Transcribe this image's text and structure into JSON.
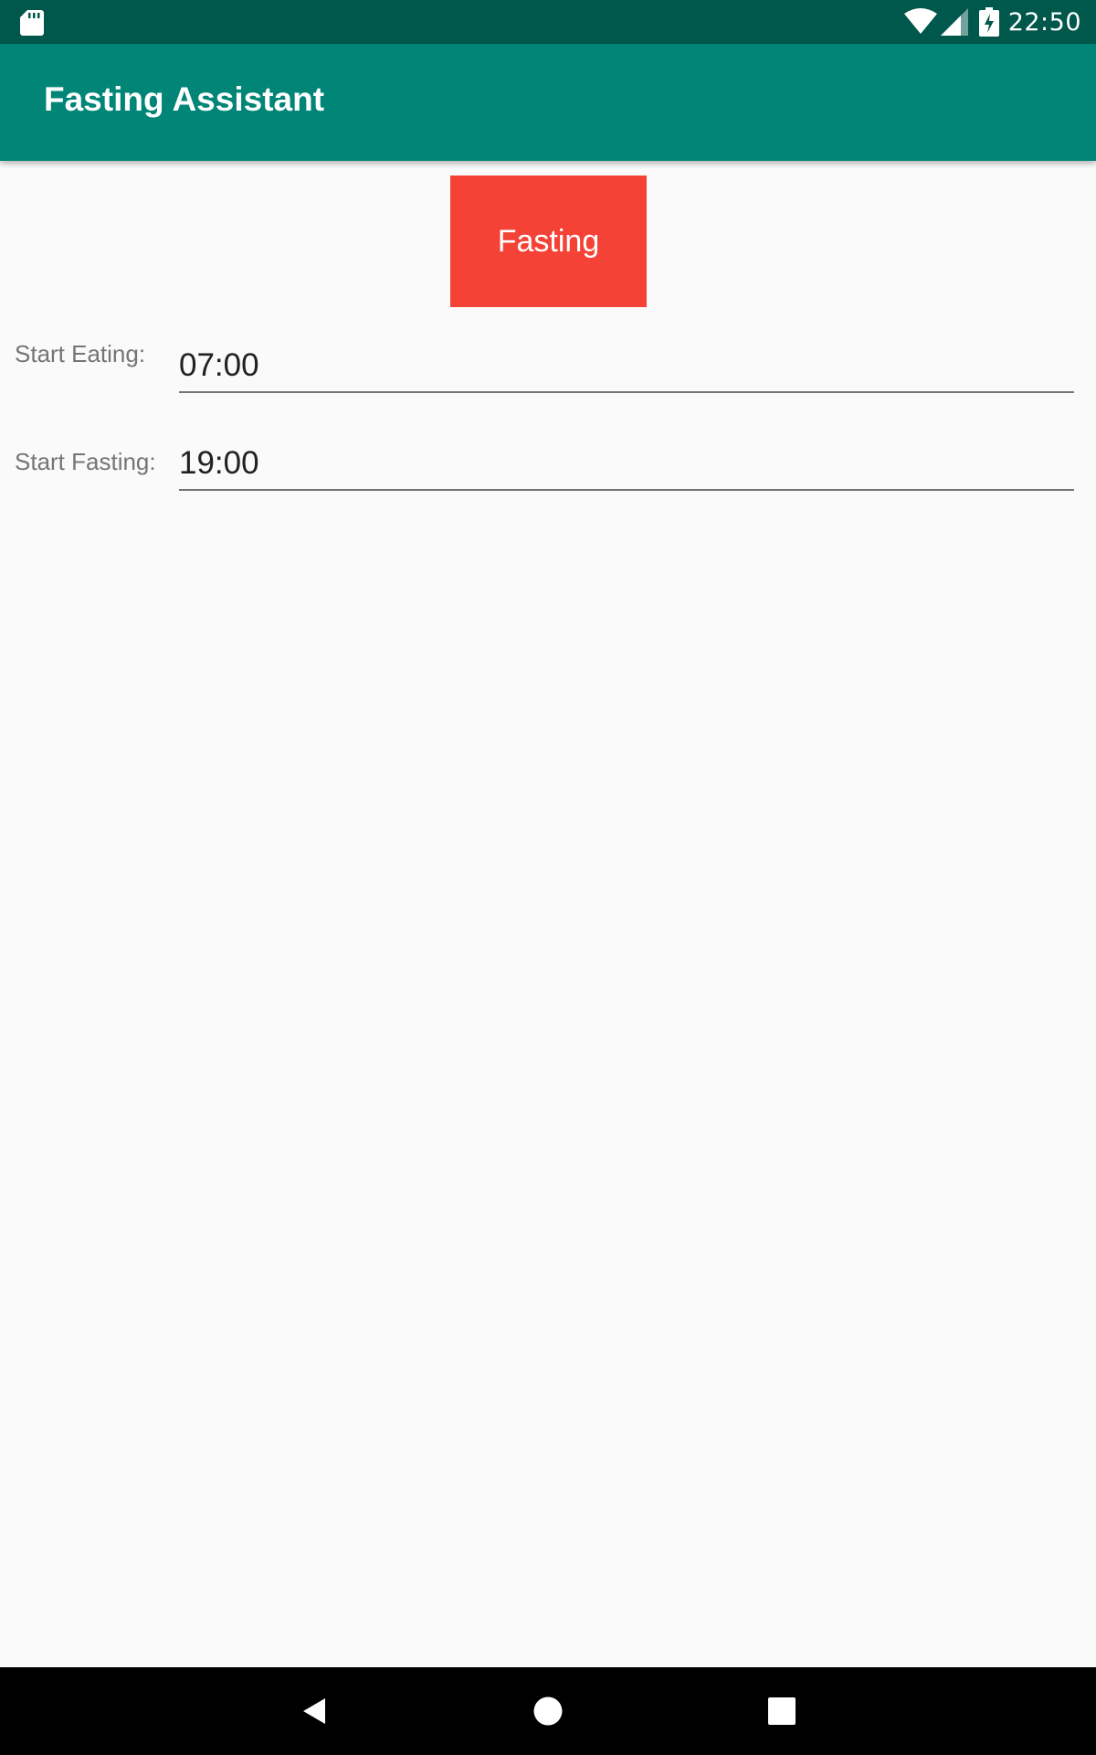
{
  "status_bar": {
    "time": "22:50",
    "icons": [
      "sd-card-icon",
      "wifi-icon",
      "cell-signal-icon",
      "battery-charging-icon"
    ]
  },
  "app_bar": {
    "title": "Fasting Assistant"
  },
  "status_button": {
    "label": "Fasting",
    "color": "#f44336"
  },
  "fields": [
    {
      "label": "Start Eating:",
      "value": "07:00"
    },
    {
      "label": "Start Fasting:",
      "value": "19:00"
    }
  ],
  "nav_bar": {
    "icons": [
      "back-icon",
      "home-icon",
      "recents-icon"
    ]
  },
  "colors": {
    "primary": "#008577",
    "primary_dark": "#00574b",
    "background": "#fafafa"
  }
}
